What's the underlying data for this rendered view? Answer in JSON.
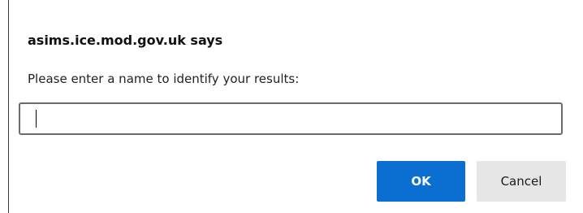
{
  "dialog": {
    "title": "asims.ice.mod.gov.uk says",
    "message": "Please enter a name to identify your results:",
    "input": {
      "value": "",
      "placeholder": ""
    },
    "buttons": {
      "ok_label": "OK",
      "cancel_label": "Cancel"
    }
  },
  "colors": {
    "ok_background": "#0a6fd1",
    "cancel_background": "#e6e6e6"
  }
}
